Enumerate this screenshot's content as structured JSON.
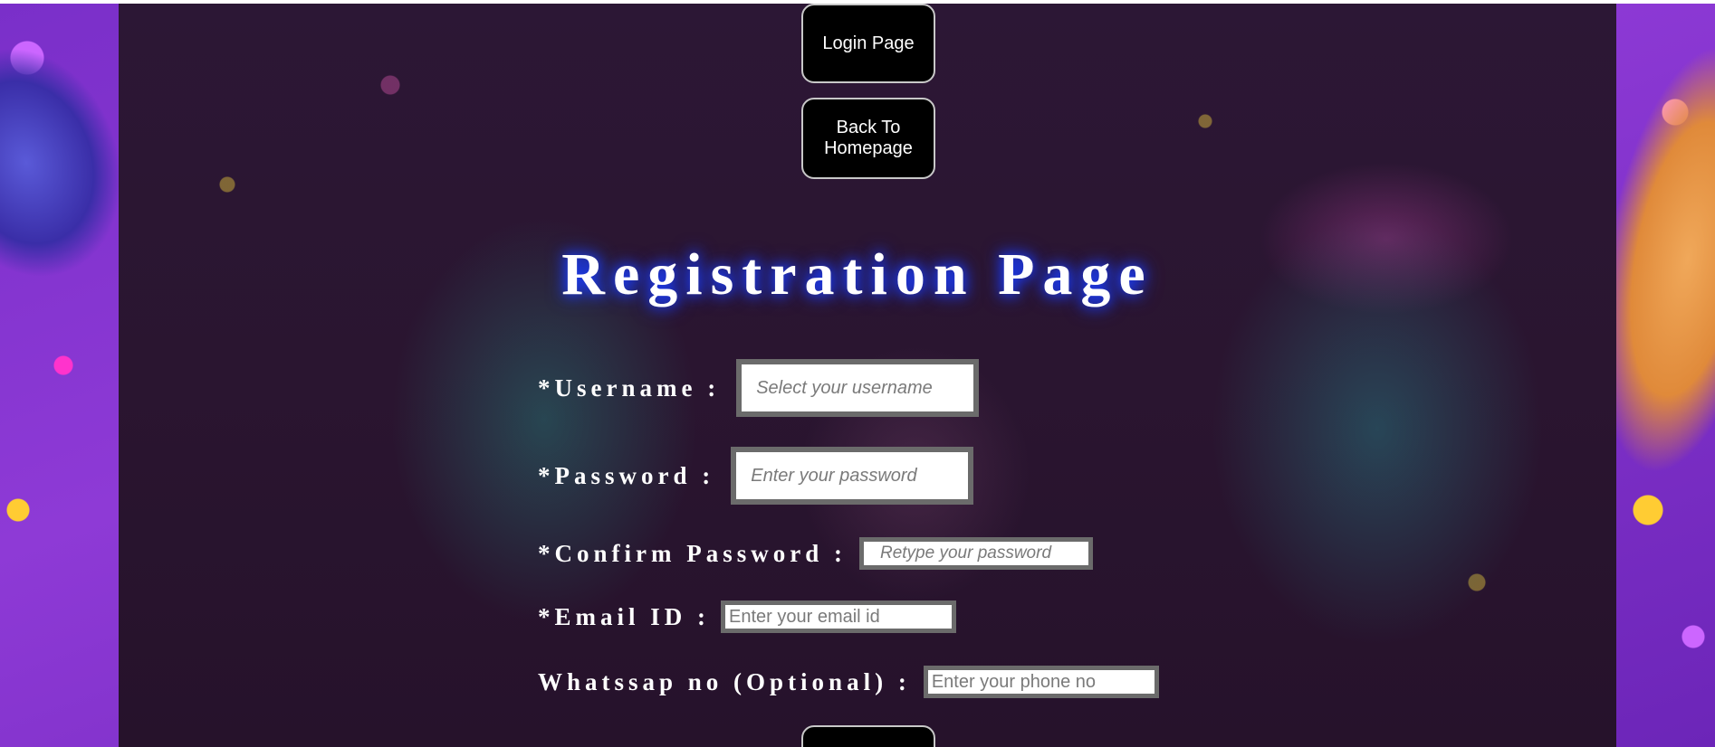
{
  "nav": {
    "login_label": "Login Page",
    "home_label": "Back To Homepage"
  },
  "page": {
    "title": "Registration Page"
  },
  "form": {
    "username": {
      "label": "*Username :",
      "placeholder": "Select your username",
      "value": ""
    },
    "password": {
      "label": "*Password :",
      "placeholder": "Enter your password",
      "value": ""
    },
    "confirm_password": {
      "label": "*Confirm Password :",
      "placeholder": "Retype your password",
      "value": ""
    },
    "email": {
      "label": "*Email ID :",
      "placeholder": "Enter your email id",
      "value": ""
    },
    "whatsapp": {
      "label": "Whatssap no (Optional) :",
      "placeholder": "Enter your phone no",
      "value": ""
    }
  },
  "colors": {
    "panel_bg": "#2a1530",
    "page_bg": "#8e3ad6",
    "title_glow": "#1a3dff",
    "button_bg": "#000000",
    "input_border": "#6b6b6b"
  }
}
